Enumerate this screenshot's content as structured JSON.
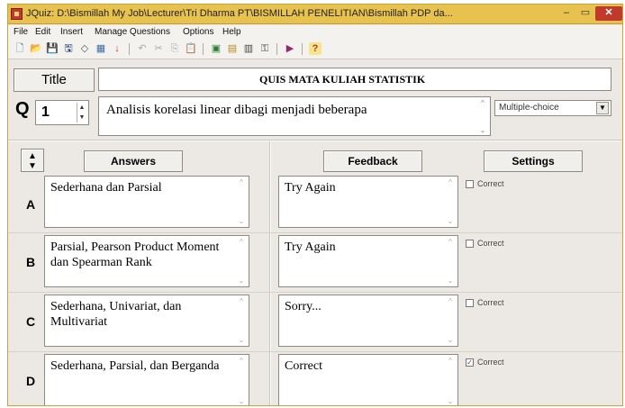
{
  "window": {
    "title": "JQuiz: D:\\Bismillah My Job\\Lecturer\\Tri Dharma PT\\BISMILLAH PENELITIAN\\Bismillah PDP da...",
    "minimize": "–",
    "maximize": "▭",
    "close": "✕"
  },
  "menu": [
    "File",
    "Edit",
    "Insert",
    "Manage Questions",
    "Options",
    "Help"
  ],
  "toolbar": {
    "icons": [
      "new-file-icon",
      "open-folder-icon",
      "save-icon",
      "save-as-icon",
      "diamond-icon",
      "export-icon",
      "down-arrow-icon",
      "undo-icon",
      "cut-icon",
      "copy-icon",
      "paste-icon",
      "config-icon",
      "web-export-icon",
      "tools-icon",
      "key-icon",
      "media-icon",
      "help-icon"
    ],
    "glyphs": [
      "🗋",
      "📂",
      "💾",
      "🖫",
      "◇",
      "▦",
      "↓",
      "↶",
      "✂",
      "⎘",
      "📋",
      "▣",
      "▤",
      "▥",
      "⚿",
      "▶",
      "?"
    ]
  },
  "title_label": "Title",
  "quiz_title": "QUIS MATA KULIAH STATISTIK",
  "question": {
    "label": "Q",
    "number": "1",
    "text": "Analisis korelasi linear dibagi menjadi beberapa",
    "type": "Multiple-choice"
  },
  "headers": {
    "reorder": "▲\n▼",
    "answers": "Answers",
    "feedback": "Feedback",
    "settings": "Settings"
  },
  "correct_label": "Correct",
  "rows": [
    {
      "letter": "A",
      "answer": "Sederhana dan Parsial",
      "feedback": "Try Again",
      "correct": false
    },
    {
      "letter": "B",
      "answer": "Parsial, Pearson Product Moment dan Spearman Rank",
      "feedback": "Try Again",
      "correct": false
    },
    {
      "letter": "C",
      "answer": "Sederhana, Univariat, dan Multivariat",
      "feedback": "Sorry...",
      "correct": false
    },
    {
      "letter": "D",
      "answer": "Sederhana, Parsial, dan Berganda",
      "feedback": "Correct",
      "correct": true
    }
  ]
}
